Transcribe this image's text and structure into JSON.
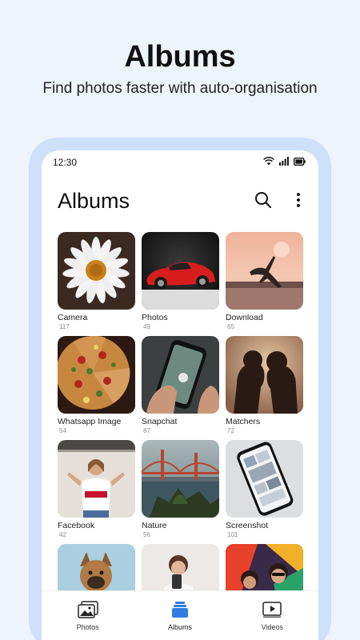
{
  "promo": {
    "title": "Albums",
    "subtitle": "Find photos faster with auto-organisation"
  },
  "status_bar": {
    "time": "12:30",
    "icons": [
      "wifi-icon",
      "signal-icon",
      "battery-icon"
    ]
  },
  "header": {
    "title": "Albums",
    "icons": [
      "search-icon",
      "more-vertical-icon"
    ]
  },
  "albums": [
    {
      "name": "Camera",
      "count": "117"
    },
    {
      "name": "Photos",
      "count": "49"
    },
    {
      "name": "Download",
      "count": "65"
    },
    {
      "name": "Whatsapp Image",
      "count": "54"
    },
    {
      "name": "Snapchat",
      "count": "87"
    },
    {
      "name": "Matchers",
      "count": "72"
    },
    {
      "name": "Facebook",
      "count": "42"
    },
    {
      "name": "Nature",
      "count": "56"
    },
    {
      "name": "Screenshot",
      "count": "101"
    },
    {
      "name": "",
      "count": ""
    },
    {
      "name": "",
      "count": ""
    },
    {
      "name": "",
      "count": ""
    }
  ],
  "bottom_nav": [
    {
      "label": "Photos",
      "icon": "image-icon",
      "active": false
    },
    {
      "label": "Albums",
      "icon": "albums-stack-icon",
      "active": true
    },
    {
      "label": "Videos",
      "icon": "play-icon",
      "active": false
    }
  ],
  "colors": {
    "background": "#eef4fc",
    "frame": "#cfe0fb",
    "accent": "#2f7de1"
  }
}
